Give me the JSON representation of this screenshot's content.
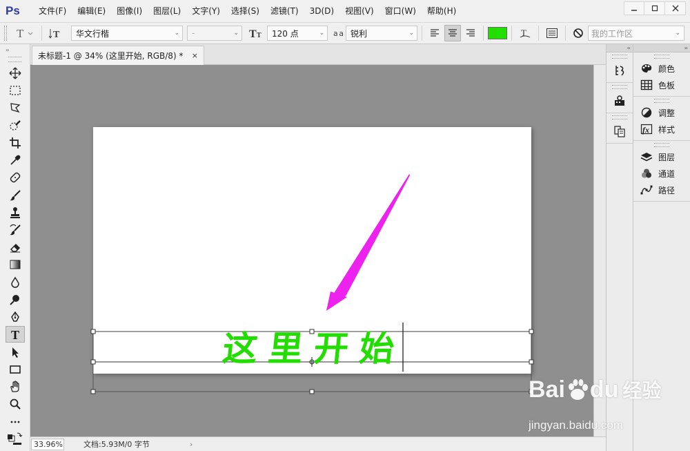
{
  "app": {
    "logo": "Ps"
  },
  "menu": {
    "items": [
      {
        "label": "文件(F)"
      },
      {
        "label": "编辑(E)"
      },
      {
        "label": "图像(I)"
      },
      {
        "label": "图层(L)"
      },
      {
        "label": "文字(Y)"
      },
      {
        "label": "选择(S)"
      },
      {
        "label": "滤镜(T)"
      },
      {
        "label": "3D(D)"
      },
      {
        "label": "视图(V)"
      },
      {
        "label": "窗口(W)"
      },
      {
        "label": "帮助(H)"
      }
    ]
  },
  "options": {
    "font_family": "华文行楷",
    "font_style": "-",
    "font_size": "120 点",
    "antialias_icon_label": "a a",
    "antialias": "锐利",
    "text_color": "#22dd00",
    "workspace": "我的工作区"
  },
  "document": {
    "tab_title": "未标题-1 @ 34% (这里开始, RGB/8) *",
    "tab_close": "×",
    "text_content": "这里开始",
    "text_color": "#22dd00",
    "arrow_color": "#ee22ee"
  },
  "status": {
    "zoom": "33.96%",
    "doc_info": "文档:5.93M/0 字节",
    "arrow": "›"
  },
  "panels": {
    "group1": [
      {
        "label": "颜色",
        "icon": "palette-icon"
      },
      {
        "label": "色板",
        "icon": "swatches-icon"
      }
    ],
    "group2": [
      {
        "label": "调整",
        "icon": "adjustments-icon"
      },
      {
        "label": "样式",
        "icon": "styles-icon"
      }
    ],
    "group3": [
      {
        "label": "图层",
        "icon": "layers-icon"
      },
      {
        "label": "通道",
        "icon": "channels-icon"
      },
      {
        "label": "路径",
        "icon": "paths-icon"
      }
    ]
  },
  "watermark": {
    "brand": "Bai",
    "brand2": "du",
    "product": "经验",
    "url": "jingyan.baidu.com"
  },
  "collapse_glyph": "‹‹",
  "expand_glyph": "››"
}
